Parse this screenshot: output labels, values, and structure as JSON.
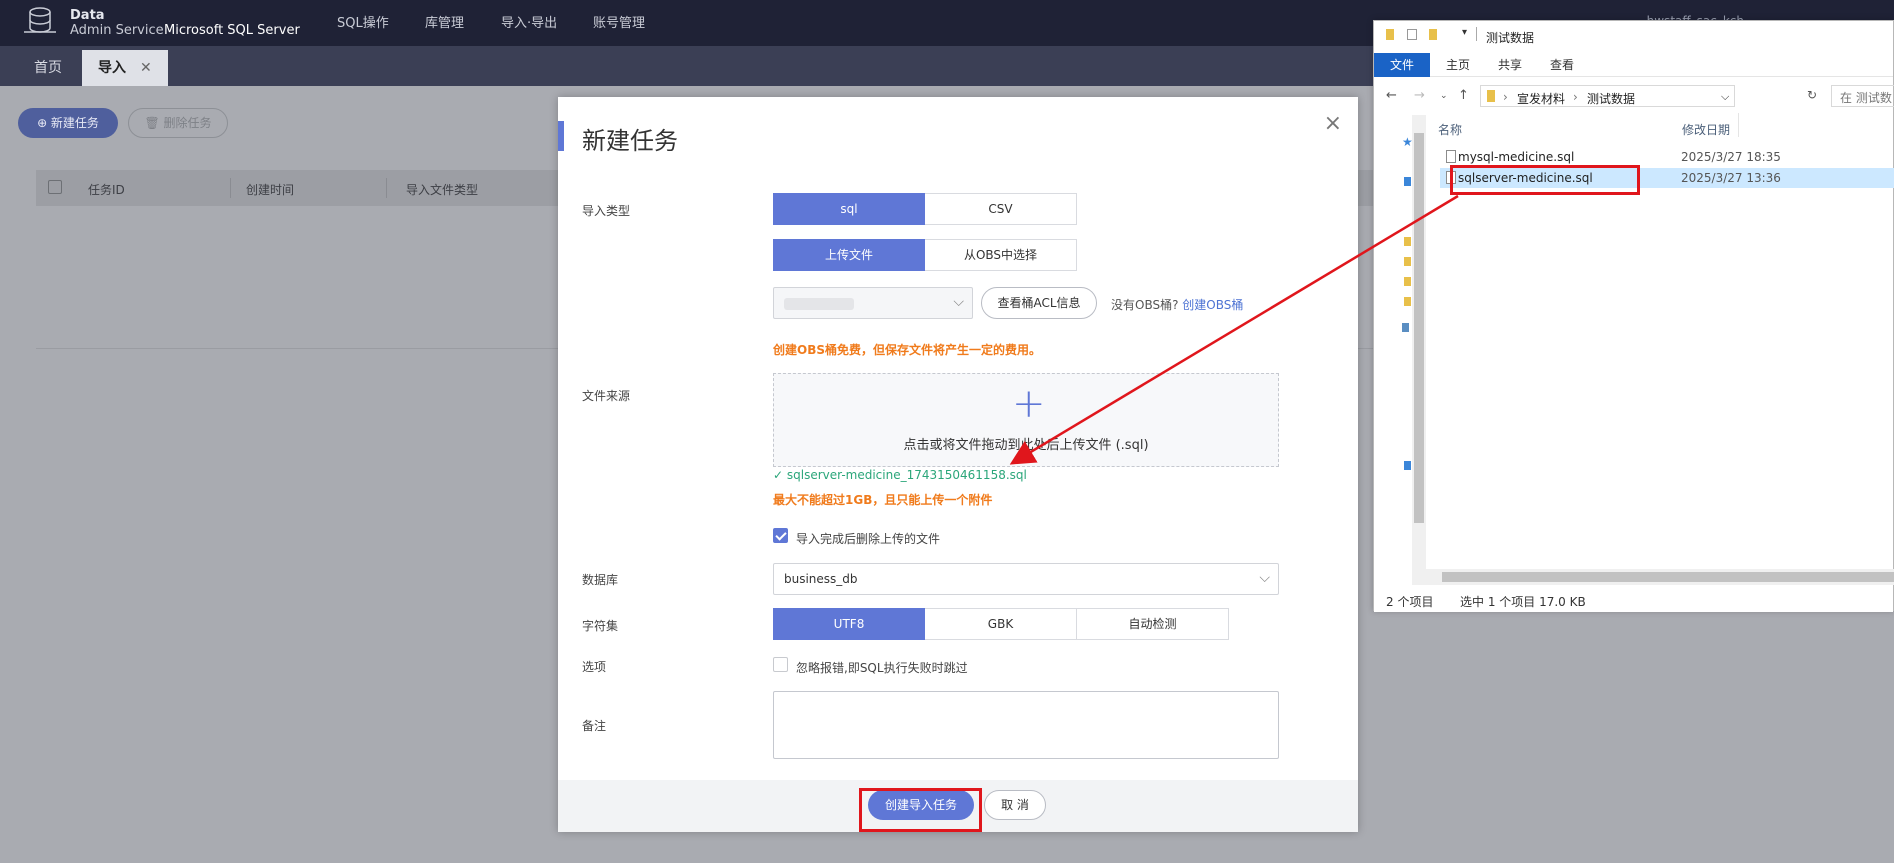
{
  "topbar": {
    "brand_line1": "Data",
    "brand_line2": "Admin Service",
    "brand_db": "Microsoft SQL Server",
    "nav": [
      "SQL操作",
      "库管理",
      "导入·导出",
      "账号管理"
    ],
    "user": "hwstaff_sac_kch"
  },
  "tabs": {
    "home": "首页",
    "import": "导入",
    "close": "✕"
  },
  "page": {
    "new_task": "⊕ 新建任务",
    "delete_task": "🗑 删除任务",
    "columns": [
      "任务ID",
      "创建时间",
      "导入文件类型"
    ]
  },
  "modal": {
    "title": "新建任务",
    "close": "×",
    "import_type_label": "导入类型",
    "import_types": [
      "sql",
      "CSV"
    ],
    "upload_modes": [
      "上传文件",
      "从OBS中选择"
    ],
    "acl_button": "查看桶ACL信息",
    "no_obs_text": "没有OBS桶?",
    "create_obs_link": "创建OBS桶",
    "obs_warning": "创建OBS桶免费，但保存文件将产生一定的费用。",
    "file_source_label": "文件来源",
    "upload_plus": "+",
    "upload_hint": "点击或将文件拖动到此处后上传文件 (.sql)",
    "uploaded_file": "sqlserver-medicine_1743150461158.sql",
    "size_warning": "最大不能超过1GB，且只能上传一个附件",
    "delete_after_label": "导入完成后删除上传的文件",
    "database_label": "数据库",
    "database_value": "business_db",
    "charset_label": "字符集",
    "charsets": [
      "UTF8",
      "GBK",
      "自动检测"
    ],
    "options_label": "选项",
    "ignore_errors_label": "忽略报错,即SQL执行失败时跳过",
    "remark_label": "备注",
    "create_button": "创建导入任务",
    "cancel_button": "取 消"
  },
  "explorer": {
    "title": "测试数据",
    "ribbon_tabs": [
      "文件",
      "主页",
      "共享",
      "查看"
    ],
    "path": [
      "宣发材料",
      "测试数据"
    ],
    "search_placeholder": "在 测试数",
    "col_name": "名称",
    "col_date": "修改日期",
    "files": [
      {
        "name": "mysql-medicine.sql",
        "date": "2025/3/27 18:35"
      },
      {
        "name": "sqlserver-medicine.sql",
        "date": "2025/3/27 13:36"
      }
    ],
    "status_count": "2 个项目",
    "status_selected": "选中 1 个项目  17.0 KB"
  },
  "colors": {
    "accent": "#5f77d6",
    "warning": "#f07b1c",
    "success": "#2ba67a",
    "annotation": "#e0161c"
  }
}
